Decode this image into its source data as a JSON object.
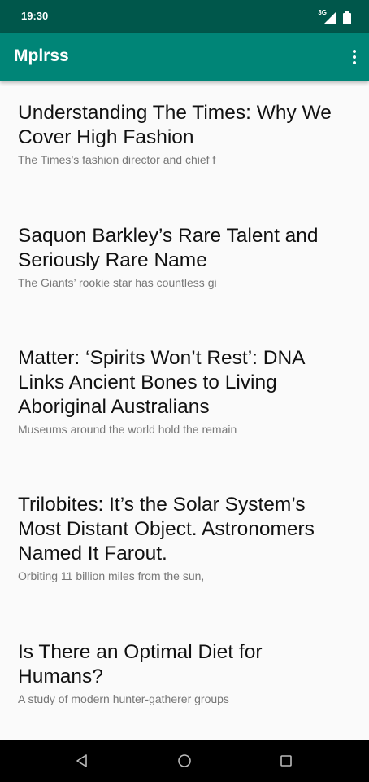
{
  "status_bar": {
    "time": "19:30",
    "network": "3G"
  },
  "app_bar": {
    "title": "Mplrss"
  },
  "articles": [
    {
      "title": "Understanding The Times: Why We Cover High Fashion",
      "summary": "The Times’s fashion director and chief f"
    },
    {
      "title": "Saquon Barkley’s Rare Talent and Seriously Rare Name",
      "summary": "The Giants’ rookie star has countless gi"
    },
    {
      "title": "Matter: ‘Spirits Won’t Rest’: DNA Links Ancient Bones to Living Aboriginal Australians",
      "summary": "Museums around the world hold the remain"
    },
    {
      "title": "Trilobites: It’s the Solar System’s Most Distant Object. Astronomers Named It Farout.",
      "summary": "Orbiting 11 billion miles from the sun,"
    },
    {
      "title": "Is There an Optimal Diet for Humans?",
      "summary": "A study of modern hunter-gatherer groups"
    }
  ],
  "icons": {
    "overflow": "more-vert-icon",
    "back": "back-icon",
    "home": "home-icon",
    "recents": "recents-icon"
  },
  "colors": {
    "status_bar": "#00574b",
    "app_bar": "#008577",
    "background": "#fafafa"
  }
}
